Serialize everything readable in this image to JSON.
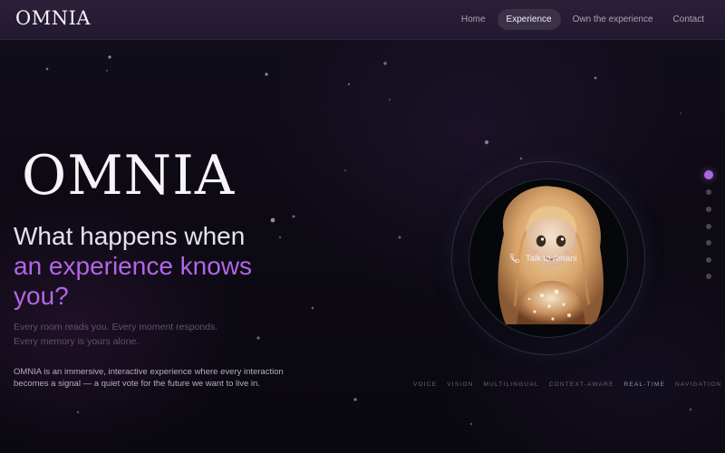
{
  "header": {
    "logo": "OMNIA",
    "nav": [
      {
        "label": "Home",
        "active": false
      },
      {
        "label": "Experience",
        "active": true
      },
      {
        "label": "Own the experience",
        "active": false
      },
      {
        "label": "Contact",
        "active": false
      }
    ]
  },
  "hero": {
    "logo": "OMNIA",
    "headline_line1": "What happens when",
    "headline_line2": "an experience knows",
    "headline_line3": "you?",
    "tagline_line1": "Every room reads you. Every moment responds.",
    "tagline_line2": "Every memory is yours alone.",
    "description": "OMNIA is an immersive, interactive experience where every interaction becomes a signal — a quiet vote for the future we want to live in."
  },
  "avatar": {
    "call_label": "Talk to Amani",
    "call_icon": "phone-icon"
  },
  "features": [
    "VOICE",
    "VISION",
    "MULTILINGUAL",
    "CONTEXT-AWARE",
    "REAL-TIME",
    "NAVIGATION"
  ],
  "section_nav": {
    "count": 7,
    "active_index": 0
  },
  "colors": {
    "accent": "#b266e6",
    "background": "#0c0912",
    "header": "#261c34",
    "active_nav_pill": "#3b3248"
  }
}
